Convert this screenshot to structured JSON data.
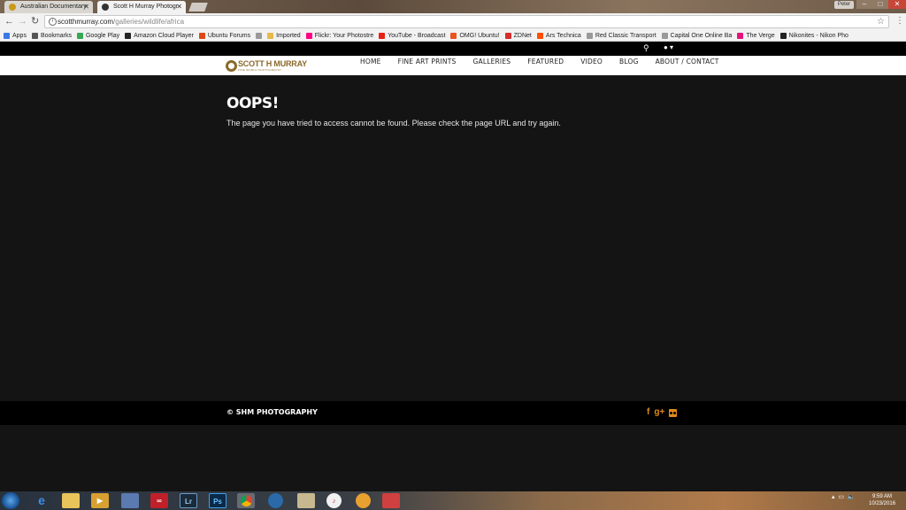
{
  "browser": {
    "tabs": [
      {
        "title": "Australian Documentary"
      },
      {
        "title": "Scott H Murray Photogr"
      }
    ],
    "window_user": "Peter",
    "url_host": "scotthmurray.com",
    "url_path": "/galleries/wildlife/africa",
    "bookmarks": [
      {
        "label": "Apps",
        "icon": "apps-grid-icon",
        "color": "#3b78e7"
      },
      {
        "label": "Bookmarks",
        "icon": "star-icon",
        "color": "#555555"
      },
      {
        "label": "Google Play",
        "icon": "play-icon",
        "color": "#34a853"
      },
      {
        "label": "Amazon Cloud Player",
        "icon": "amazon-icon",
        "color": "#222222"
      },
      {
        "label": "Ubuntu Forums",
        "icon": "ubuntu-icon",
        "color": "#dd4814"
      },
      {
        "label": "",
        "icon": "page-icon",
        "color": "#999999"
      },
      {
        "label": "Imported",
        "icon": "folder-icon",
        "color": "#e8b84a"
      },
      {
        "label": "Flickr: Your Photostre",
        "icon": "flickr-icon",
        "color": "#ff0084"
      },
      {
        "label": "YouTube - Broadcast",
        "icon": "youtube-icon",
        "color": "#e62117"
      },
      {
        "label": "OMG! Ubuntu!",
        "icon": "omg-icon",
        "color": "#e95420"
      },
      {
        "label": "ZDNet",
        "icon": "zdnet-icon",
        "color": "#d32f2f"
      },
      {
        "label": "Ars Technica",
        "icon": "ars-icon",
        "color": "#ff4e00"
      },
      {
        "label": "Red Classic Transport",
        "icon": "page-icon",
        "color": "#999999"
      },
      {
        "label": "Capital One Online Ba",
        "icon": "page-icon",
        "color": "#999999"
      },
      {
        "label": "The Verge",
        "icon": "verge-icon",
        "color": "#e5127d"
      },
      {
        "label": "Nikonites - Nikon Pho",
        "icon": "nikon-icon",
        "color": "#222222"
      }
    ]
  },
  "site": {
    "logo_text": "SCOTT H MURRAY",
    "logo_sub": "FINE WORLD PHOTOGRAPHY",
    "nav": [
      "HOME",
      "FINE ART PRINTS",
      "GALLERIES",
      "FEATURED",
      "VIDEO",
      "BLOG",
      "ABOUT / CONTACT"
    ],
    "error_title": "OOPS!",
    "error_message": "The page you have tried to access cannot be found. Please check the page URL and try again.",
    "copyright": "© SHM PHOTOGRAPHY",
    "brand_color": "#e08a1e"
  },
  "taskbar": {
    "time": "9:59 AM",
    "date": "10/23/2016"
  }
}
